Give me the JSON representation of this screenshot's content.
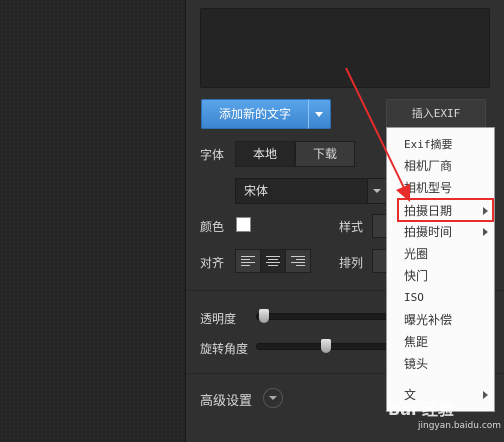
{
  "toolbar": {
    "add_text_label": "添加新的文字",
    "insert_exif_label": "插入EXIF"
  },
  "font": {
    "label": "字体",
    "source_local": "本地",
    "source_download": "下载",
    "selected": "宋体"
  },
  "color": {
    "label": "颜色",
    "value": "#ffffff"
  },
  "style": {
    "label": "样式"
  },
  "align": {
    "label": "对齐",
    "options": [
      "left",
      "center",
      "right"
    ],
    "selected": "center"
  },
  "arrange": {
    "label": "排列"
  },
  "opacity": {
    "label": "透明度",
    "value": 0.02
  },
  "rotation": {
    "label": "旋转角度",
    "value": 0.5
  },
  "advanced": {
    "label": "高级设置"
  },
  "exif_menu": {
    "items": [
      {
        "label": "Exif摘要",
        "submenu": false
      },
      {
        "label": "相机厂商",
        "submenu": false
      },
      {
        "label": "相机型号",
        "submenu": false
      },
      {
        "label": "拍摄日期",
        "submenu": true,
        "highlighted": true
      },
      {
        "label": "拍摄时间",
        "submenu": true
      },
      {
        "label": "光圈",
        "submenu": false
      },
      {
        "label": "快门",
        "submenu": false
      },
      {
        "label": "ISO",
        "submenu": false
      },
      {
        "label": "曝光补偿",
        "submenu": false
      },
      {
        "label": "焦距",
        "submenu": false
      },
      {
        "label": "镜头",
        "submenu": false
      },
      {
        "label": "文",
        "submenu": true
      }
    ]
  },
  "annotation": {
    "color": "#e82b2b"
  },
  "watermark": {
    "main": "Bai 经验",
    "sub": "jingyan.baidu.com"
  }
}
